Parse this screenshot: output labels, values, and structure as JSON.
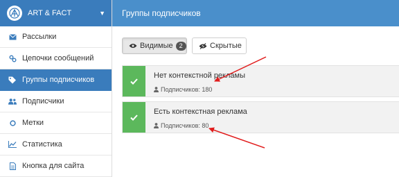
{
  "brand": {
    "name": "ART & FACT"
  },
  "sidebar": {
    "items": [
      {
        "label": "Рассылки",
        "icon": "envelope-icon"
      },
      {
        "label": "Цепочки сообщений",
        "icon": "link-icon"
      },
      {
        "label": "Группы подписчиков",
        "icon": "tags-icon",
        "active": true
      },
      {
        "label": "Подписчики",
        "icon": "users-icon"
      },
      {
        "label": "Метки",
        "icon": "circle-icon"
      },
      {
        "label": "Статистика",
        "icon": "line-chart-icon"
      },
      {
        "label": "Кнопка для сайта",
        "icon": "file-icon"
      }
    ]
  },
  "header": {
    "title": "Группы подписчиков"
  },
  "filters": {
    "visible_label": "Видимые",
    "visible_count": "2",
    "hidden_label": "Скрытые"
  },
  "groups": [
    {
      "title": "Нет контекстной рекламы",
      "subscribers": "Подписчиков: 180"
    },
    {
      "title": "Есть контекстная реклама",
      "subscribers": "Подписчиков: 80"
    }
  ],
  "colors": {
    "sidebar_header": "#3a7cbc",
    "topbar": "#4a8fcb",
    "active_item": "#3a7cbc",
    "check_green": "#5cb85c",
    "arrow_red": "#e11d1d"
  }
}
